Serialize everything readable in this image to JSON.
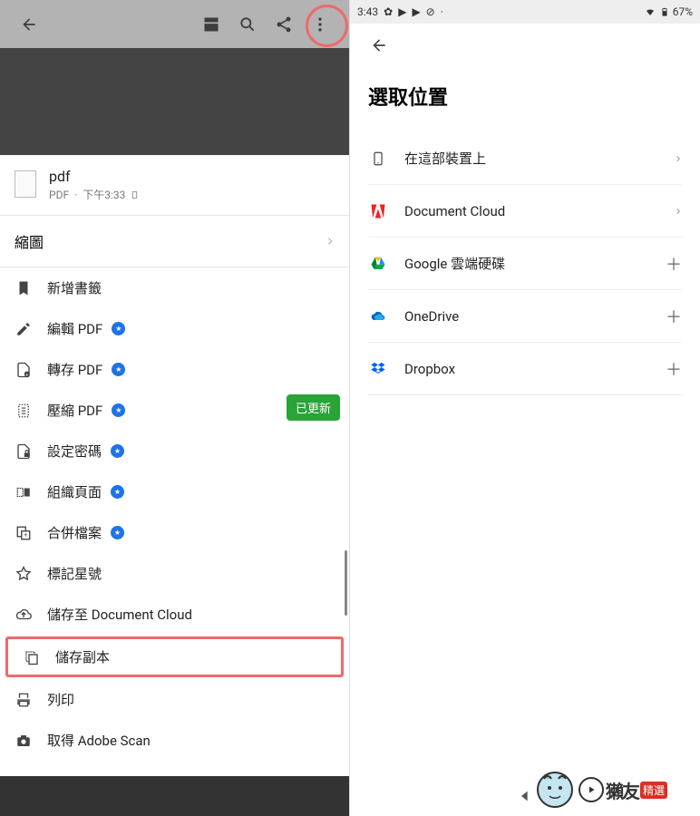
{
  "left": {
    "file": {
      "name": "pdf",
      "type": "PDF",
      "time": "下午3:33"
    },
    "thumbnails_label": "縮圖",
    "update_badge": "已更新",
    "menu": [
      {
        "key": "bookmark",
        "label": "新增書籤",
        "star": false
      },
      {
        "key": "edit",
        "label": "編輯 PDF",
        "star": true
      },
      {
        "key": "convert",
        "label": "轉存 PDF",
        "star": true
      },
      {
        "key": "compress",
        "label": "壓縮 PDF",
        "star": true
      },
      {
        "key": "password",
        "label": "設定密碼",
        "star": true
      },
      {
        "key": "organize",
        "label": "組織頁面",
        "star": true
      },
      {
        "key": "merge",
        "label": "合併檔案",
        "star": true
      },
      {
        "key": "favorite",
        "label": "標記星號",
        "star": false
      },
      {
        "key": "savecloud",
        "label": "儲存至 Document Cloud",
        "star": false
      },
      {
        "key": "savecopy",
        "label": "儲存副本",
        "star": false,
        "highlighted": true
      },
      {
        "key": "print",
        "label": "列印",
        "star": false
      },
      {
        "key": "scan",
        "label": "取得 Adobe Scan",
        "star": false
      }
    ]
  },
  "right": {
    "status": {
      "time": "3:43",
      "battery": "67%"
    },
    "title": "選取位置",
    "locations": [
      {
        "key": "device",
        "label": "在這部裝置上",
        "action": "chevron"
      },
      {
        "key": "doccloud",
        "label": "Document Cloud",
        "action": "chevron"
      },
      {
        "key": "gdrive",
        "label": "Google 雲端硬碟",
        "action": "plus"
      },
      {
        "key": "onedrive",
        "label": "OneDrive",
        "action": "plus"
      },
      {
        "key": "dropbox",
        "label": "Dropbox",
        "action": "plus"
      }
    ]
  }
}
